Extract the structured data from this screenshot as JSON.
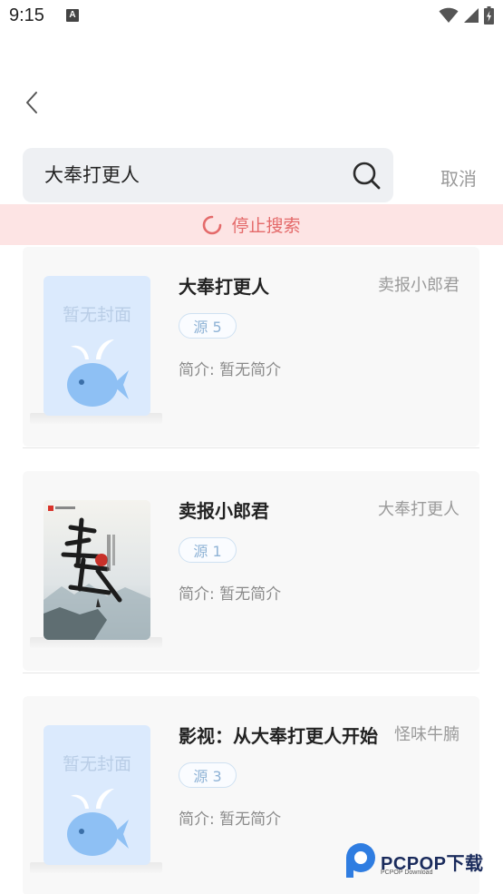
{
  "status_bar": {
    "time": "9:15",
    "a_icon": "A"
  },
  "search": {
    "query": "大奉打更人",
    "cancel_label": "取消"
  },
  "banner": {
    "stop_label": "停止搜索"
  },
  "results": [
    {
      "title": "大奉打更人",
      "author": "卖报小郎君",
      "source": "源 5",
      "intro": "简介: 暂无简介",
      "cover": "default",
      "no_cover_text": "暂无封面"
    },
    {
      "title": "卖报小郎君",
      "author": "大奉打更人",
      "source": "源 1",
      "intro": "简介: 暂无简介",
      "cover": "art"
    },
    {
      "title": "影视：从大奉打更人开始",
      "author": "怪味牛腩",
      "source": "源 3",
      "intro": "简介: 暂无简介",
      "cover": "default",
      "no_cover_text": "暂无封面"
    }
  ],
  "watermark": {
    "brand": "PCPOP下载",
    "sub": "PCPOP Download"
  },
  "colors": {
    "banner_bg": "#fde4e4",
    "banner_text": "#e46a6a",
    "cover_bg": "#dbeafd",
    "fish": "#8ec0f4"
  },
  "icons": {
    "back": "chevron-left-icon",
    "search": "search-icon",
    "spinner": "spinner-icon",
    "wifi": "wifi-icon",
    "signal": "signal-icon",
    "battery": "battery-icon"
  }
}
